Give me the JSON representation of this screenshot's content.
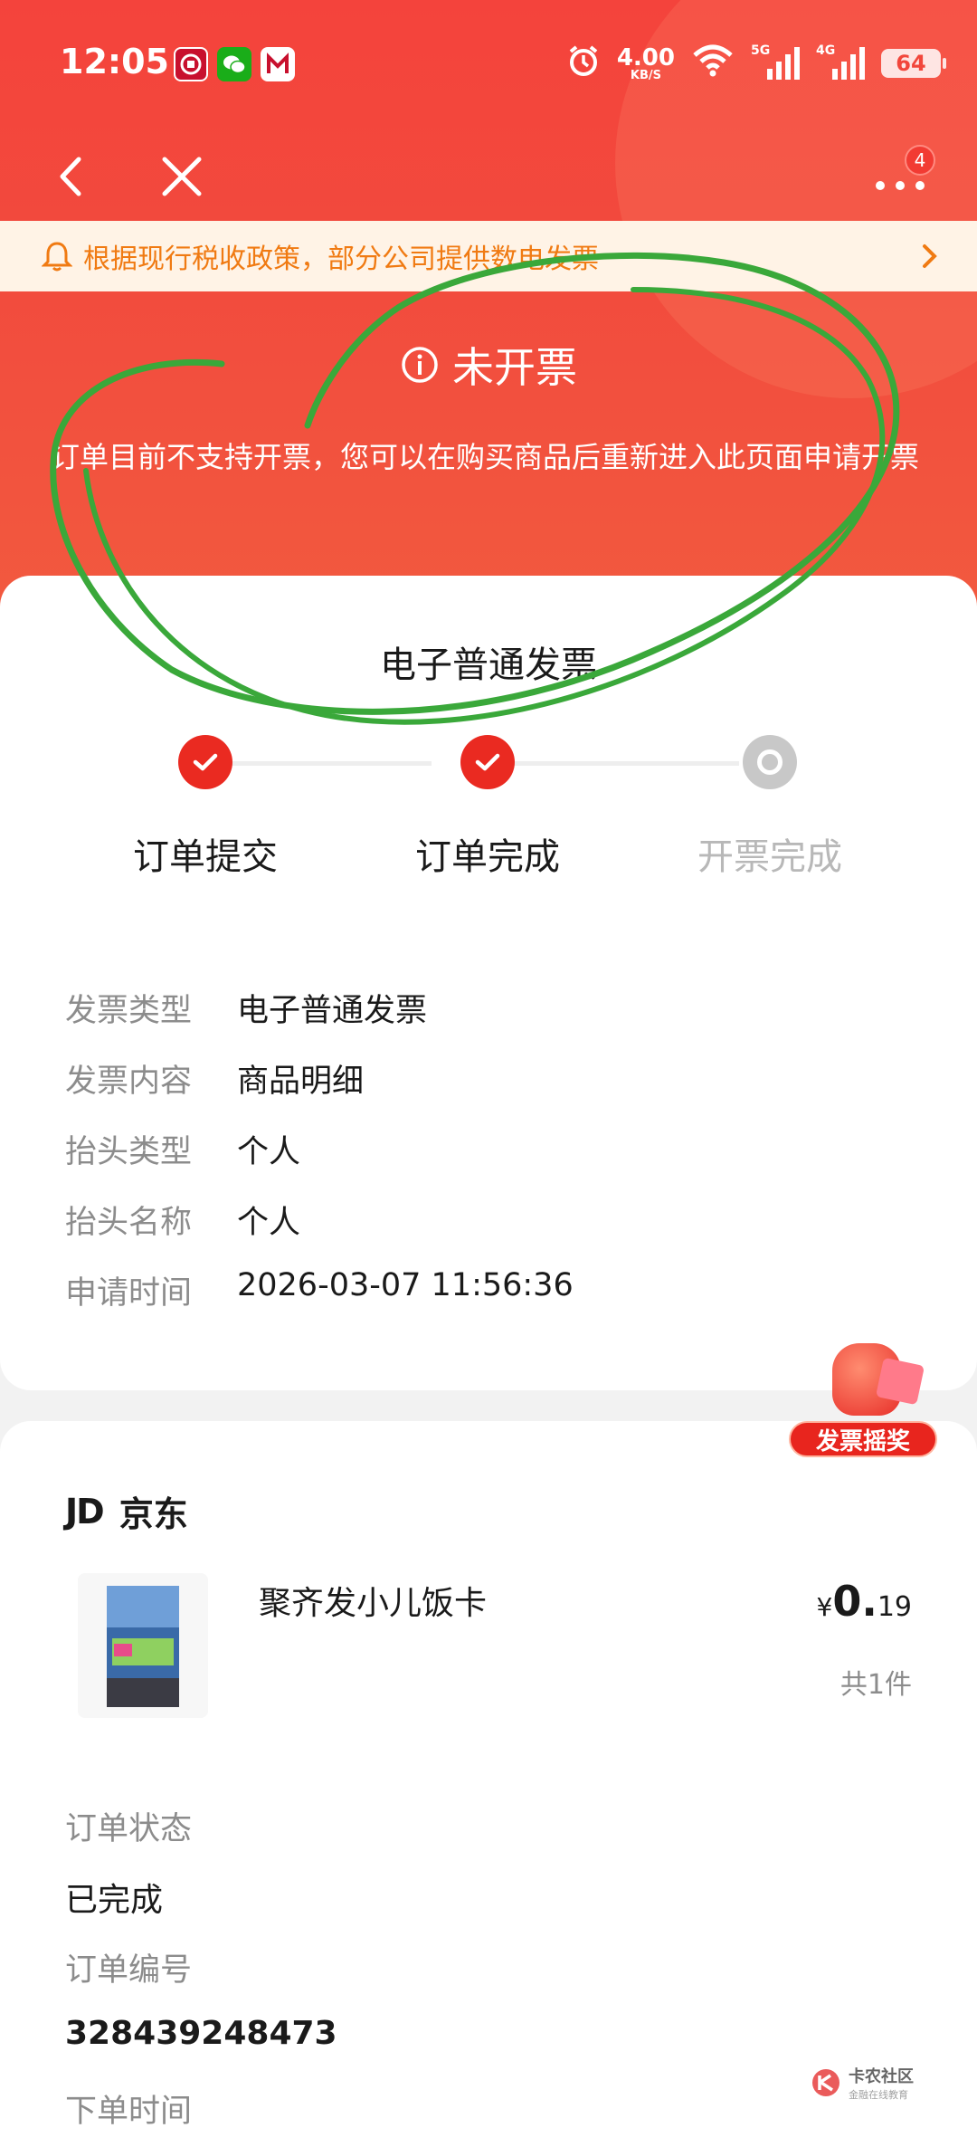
{
  "status_bar": {
    "time": "12:05",
    "net_speed_value": "4.00",
    "net_speed_unit": "KB/S",
    "signal1_label": "5G",
    "signal2_label": "4G",
    "battery": "64"
  },
  "nav": {
    "more_badge": "4"
  },
  "notice": {
    "text": "根据现行税收政策，部分公司提供数电发票"
  },
  "invoice_status": {
    "title": "未开票",
    "description": "订单目前不支持开票，您可以在购买商品后重新进入此页面申请开票"
  },
  "invoice_card": {
    "title": "电子普通发票",
    "steps": [
      {
        "label": "订单提交",
        "state": "done"
      },
      {
        "label": "订单完成",
        "state": "done"
      },
      {
        "label": "开票完成",
        "state": "pending"
      }
    ],
    "info": [
      {
        "key": "发票类型",
        "value": "电子普通发票"
      },
      {
        "key": "发票内容",
        "value": "商品明细"
      },
      {
        "key": "抬头类型",
        "value": "个人"
      },
      {
        "key": "抬头名称",
        "value": "个人"
      },
      {
        "key": "申请时间",
        "value": "2026-03-07 11:56:36"
      }
    ]
  },
  "lottery": {
    "label": "发票摇奖"
  },
  "order_card": {
    "shop_logo": "JD",
    "shop_name": "京东",
    "product": {
      "name": "聚齐发小儿饭卡",
      "price_symbol": "¥",
      "price_int": "0.",
      "price_dec": "19",
      "quantity": "共1件"
    },
    "fields": [
      {
        "key": "订单状态",
        "value": "已完成"
      },
      {
        "key": "订单编号",
        "value": "328439248473"
      },
      {
        "key": "下单时间",
        "value": ""
      }
    ]
  },
  "watermark": {
    "title": "卡农社区",
    "subtitle": "金融在线教育"
  },
  "colors": {
    "header_red": "#f4433c",
    "accent_red": "#ea2a21",
    "notice_orange": "#f07a12",
    "notice_bg": "#fff3e6",
    "annotation_green": "#3aa83a"
  }
}
